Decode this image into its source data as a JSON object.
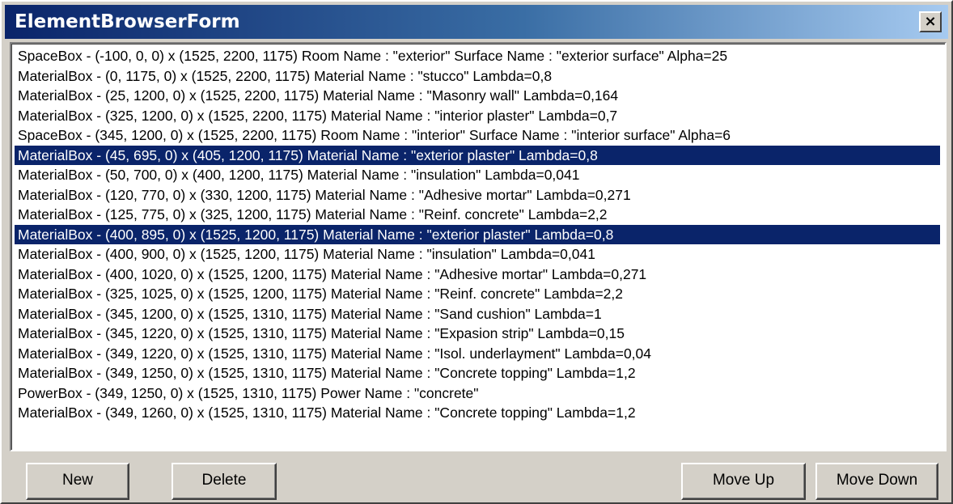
{
  "window": {
    "title": "ElementBrowserForm",
    "close_glyph": "×"
  },
  "colors": {
    "face": "#d4d0c8",
    "selection": "#0a246a",
    "titlebar_start": "#0a246a",
    "titlebar_end": "#a6caf0"
  },
  "list": {
    "items": [
      {
        "text": "SpaceBox - (-100, 0, 0) x (1525, 2200, 1175) Room Name : \"exterior\" Surface Name : \"exterior surface\" Alpha=25",
        "selected": false
      },
      {
        "text": "MaterialBox - (0, 1175, 0) x (1525, 2200, 1175) Material Name : \"stucco\" Lambda=0,8",
        "selected": false
      },
      {
        "text": "MaterialBox - (25, 1200, 0) x (1525, 2200, 1175) Material Name : \"Masonry wall\" Lambda=0,164",
        "selected": false
      },
      {
        "text": "MaterialBox - (325, 1200, 0) x (1525, 2200, 1175) Material Name : \"interior plaster\" Lambda=0,7",
        "selected": false
      },
      {
        "text": "SpaceBox - (345, 1200, 0) x (1525, 2200, 1175) Room Name : \"interior\" Surface Name : \"interior surface\" Alpha=6",
        "selected": false
      },
      {
        "text": "MaterialBox - (45, 695, 0) x (405, 1200, 1175) Material Name : \"exterior plaster\" Lambda=0,8",
        "selected": true
      },
      {
        "text": "MaterialBox - (50, 700, 0) x (400, 1200, 1175) Material Name : \"insulation\" Lambda=0,041",
        "selected": false
      },
      {
        "text": "MaterialBox - (120, 770, 0) x (330, 1200, 1175) Material Name : \"Adhesive mortar\" Lambda=0,271",
        "selected": false
      },
      {
        "text": "MaterialBox - (125, 775, 0) x (325, 1200, 1175) Material Name : \"Reinf. concrete\" Lambda=2,2",
        "selected": false
      },
      {
        "text": "MaterialBox - (400, 895, 0) x (1525, 1200, 1175) Material Name : \"exterior plaster\" Lambda=0,8",
        "selected": true
      },
      {
        "text": "MaterialBox - (400, 900, 0) x (1525, 1200, 1175) Material Name : \"insulation\" Lambda=0,041",
        "selected": false
      },
      {
        "text": "MaterialBox - (400, 1020, 0) x (1525, 1200, 1175) Material Name : \"Adhesive mortar\" Lambda=0,271",
        "selected": false
      },
      {
        "text": "MaterialBox - (325, 1025, 0) x (1525, 1200, 1175) Material Name : \"Reinf. concrete\" Lambda=2,2",
        "selected": false
      },
      {
        "text": "MaterialBox - (345, 1200, 0) x (1525, 1310, 1175) Material Name : \"Sand cushion\" Lambda=1",
        "selected": false
      },
      {
        "text": "MaterialBox - (345, 1220, 0) x (1525, 1310, 1175) Material Name : \"Expasion strip\" Lambda=0,15",
        "selected": false
      },
      {
        "text": "MaterialBox - (349, 1220, 0) x (1525, 1310, 1175) Material Name : \"Isol. underlayment\" Lambda=0,04",
        "selected": false
      },
      {
        "text": "MaterialBox - (349, 1250, 0) x (1525, 1310, 1175) Material Name : \"Concrete topping\" Lambda=1,2",
        "selected": false
      },
      {
        "text": "PowerBox - (349, 1250, 0) x (1525, 1310, 1175) Power Name : \"concrete\"",
        "selected": false
      },
      {
        "text": "MaterialBox - (349, 1260, 0) x (1525, 1310, 1175) Material Name : \"Concrete topping\" Lambda=1,2",
        "selected": false
      }
    ]
  },
  "buttons": {
    "new": "New",
    "delete": "Delete",
    "move_up": "Move Up",
    "move_down": "Move Down"
  }
}
